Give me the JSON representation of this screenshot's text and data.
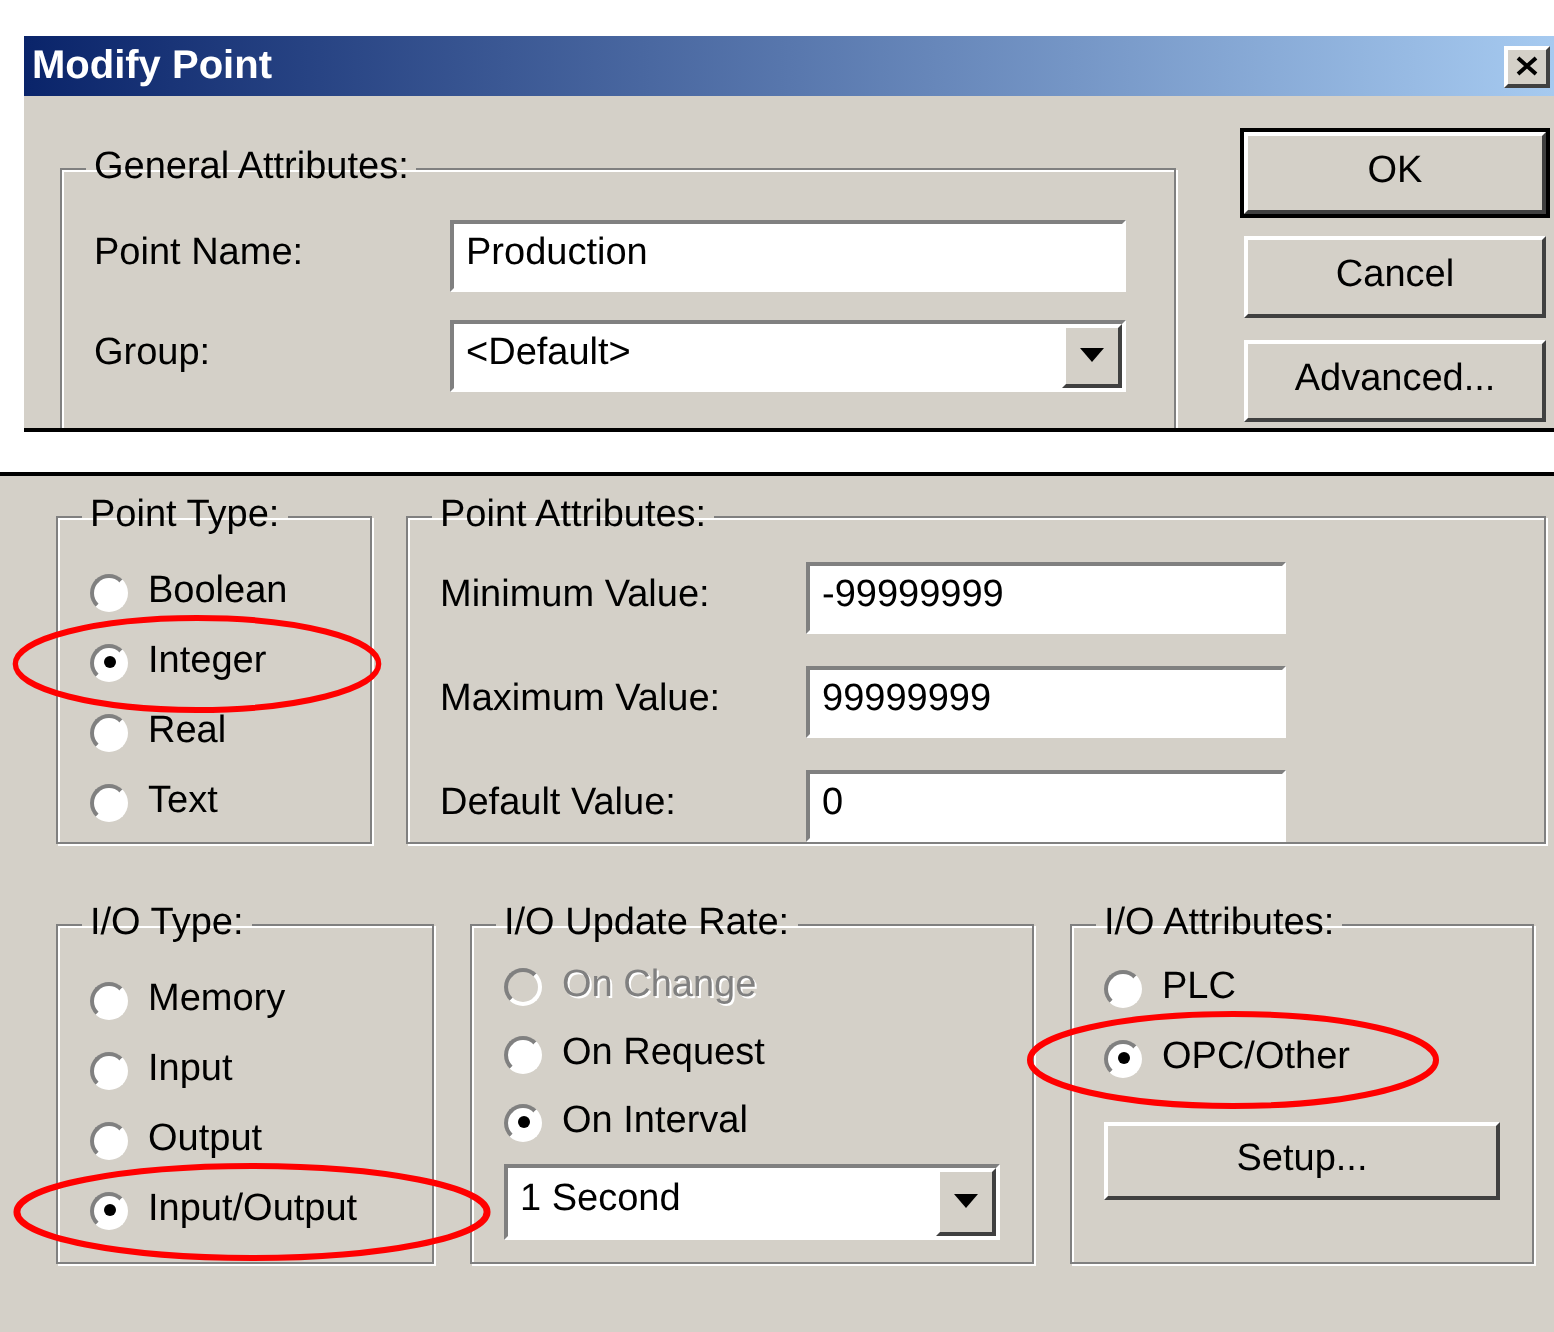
{
  "window": {
    "title": "Modify Point"
  },
  "general_attributes": {
    "title": "General Attributes:",
    "fields": [
      {
        "kind": "text",
        "label": "Point Name:",
        "value": "Production"
      },
      {
        "kind": "combo",
        "label": "Group:",
        "value": "<Default>"
      }
    ]
  },
  "buttons": [
    {
      "label": "OK",
      "default": true
    },
    {
      "label": "Cancel",
      "default": false
    },
    {
      "label": "Advanced...",
      "default": false
    }
  ],
  "point_type": {
    "title": "Point Type:",
    "options": [
      {
        "label": "Boolean",
        "selected": false,
        "highlighted": false
      },
      {
        "label": "Integer",
        "selected": true,
        "highlighted": true
      },
      {
        "label": "Real",
        "selected": false,
        "highlighted": false
      },
      {
        "label": "Text",
        "selected": false,
        "highlighted": false
      }
    ]
  },
  "point_attributes": {
    "title": "Point Attributes:",
    "fields": [
      {
        "label": "Minimum Value:",
        "value": "-99999999"
      },
      {
        "label": "Maximum Value:",
        "value": "99999999"
      },
      {
        "label": "Default Value:",
        "value": "0"
      }
    ]
  },
  "io_type": {
    "title": "I/O Type:",
    "options": [
      {
        "label": "Memory",
        "selected": false,
        "highlighted": false
      },
      {
        "label": "Input",
        "selected": false,
        "highlighted": false
      },
      {
        "label": "Output",
        "selected": false,
        "highlighted": false
      },
      {
        "label": "Input/Output",
        "selected": true,
        "highlighted": true
      }
    ]
  },
  "io_update_rate": {
    "title": "I/O Update Rate:",
    "options": [
      {
        "label": "On Change",
        "selected": false,
        "disabled": true
      },
      {
        "label": "On Request",
        "selected": false,
        "disabled": false
      },
      {
        "label": "On Interval",
        "selected": true,
        "disabled": false
      }
    ],
    "interval": {
      "value": "1 Second"
    }
  },
  "io_attributes": {
    "title": "I/O Attributes:",
    "options": [
      {
        "label": "PLC",
        "selected": false,
        "highlighted": false
      },
      {
        "label": "OPC/Other",
        "selected": true,
        "highlighted": true
      }
    ],
    "button": {
      "label": "Setup..."
    }
  }
}
